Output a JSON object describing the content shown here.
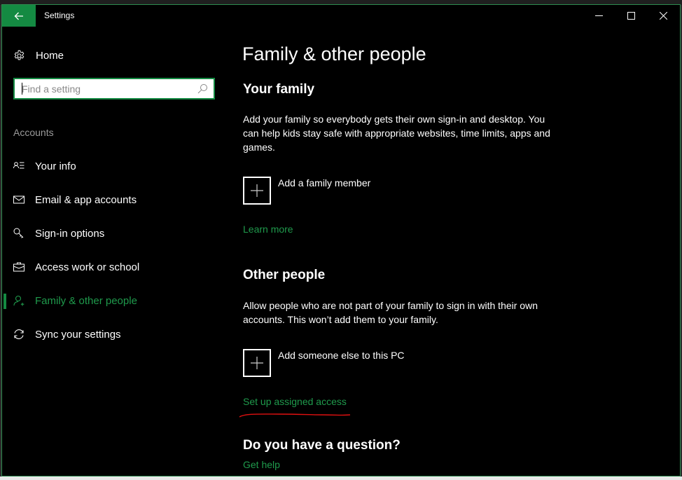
{
  "window": {
    "title": "Settings",
    "controls": {
      "minimize": "minimize",
      "maximize": "maximize",
      "close": "close"
    },
    "accent_color": "#148a42",
    "link_color": "#1f9a4c"
  },
  "sidebar": {
    "home_label": "Home",
    "search": {
      "placeholder": "Find a setting",
      "value": ""
    },
    "section_label": "Accounts",
    "items": [
      {
        "label": "Your info",
        "icon": "contact-info-icon",
        "active": false
      },
      {
        "label": "Email & app accounts",
        "icon": "mail-icon",
        "active": false
      },
      {
        "label": "Sign-in options",
        "icon": "key-icon",
        "active": false
      },
      {
        "label": "Access work or school",
        "icon": "briefcase-icon",
        "active": false
      },
      {
        "label": "Family & other people",
        "icon": "add-person-icon",
        "active": true
      },
      {
        "label": "Sync your settings",
        "icon": "sync-icon",
        "active": false
      }
    ]
  },
  "main": {
    "title": "Family & other people",
    "your_family": {
      "heading": "Your family",
      "description": "Add your family so everybody gets their own sign-in and desktop. You can help kids stay safe with appropriate websites, time limits, apps and games.",
      "add_label": "Add a family member",
      "learn_more": "Learn more"
    },
    "other_people": {
      "heading": "Other people",
      "description": "Allow people who are not part of your family to sign in with their own accounts. This won’t add them to your family.",
      "add_label": "Add someone else to this PC",
      "assigned_access": "Set up assigned access"
    },
    "question": {
      "heading": "Do you have a question?",
      "get_help": "Get help"
    }
  }
}
